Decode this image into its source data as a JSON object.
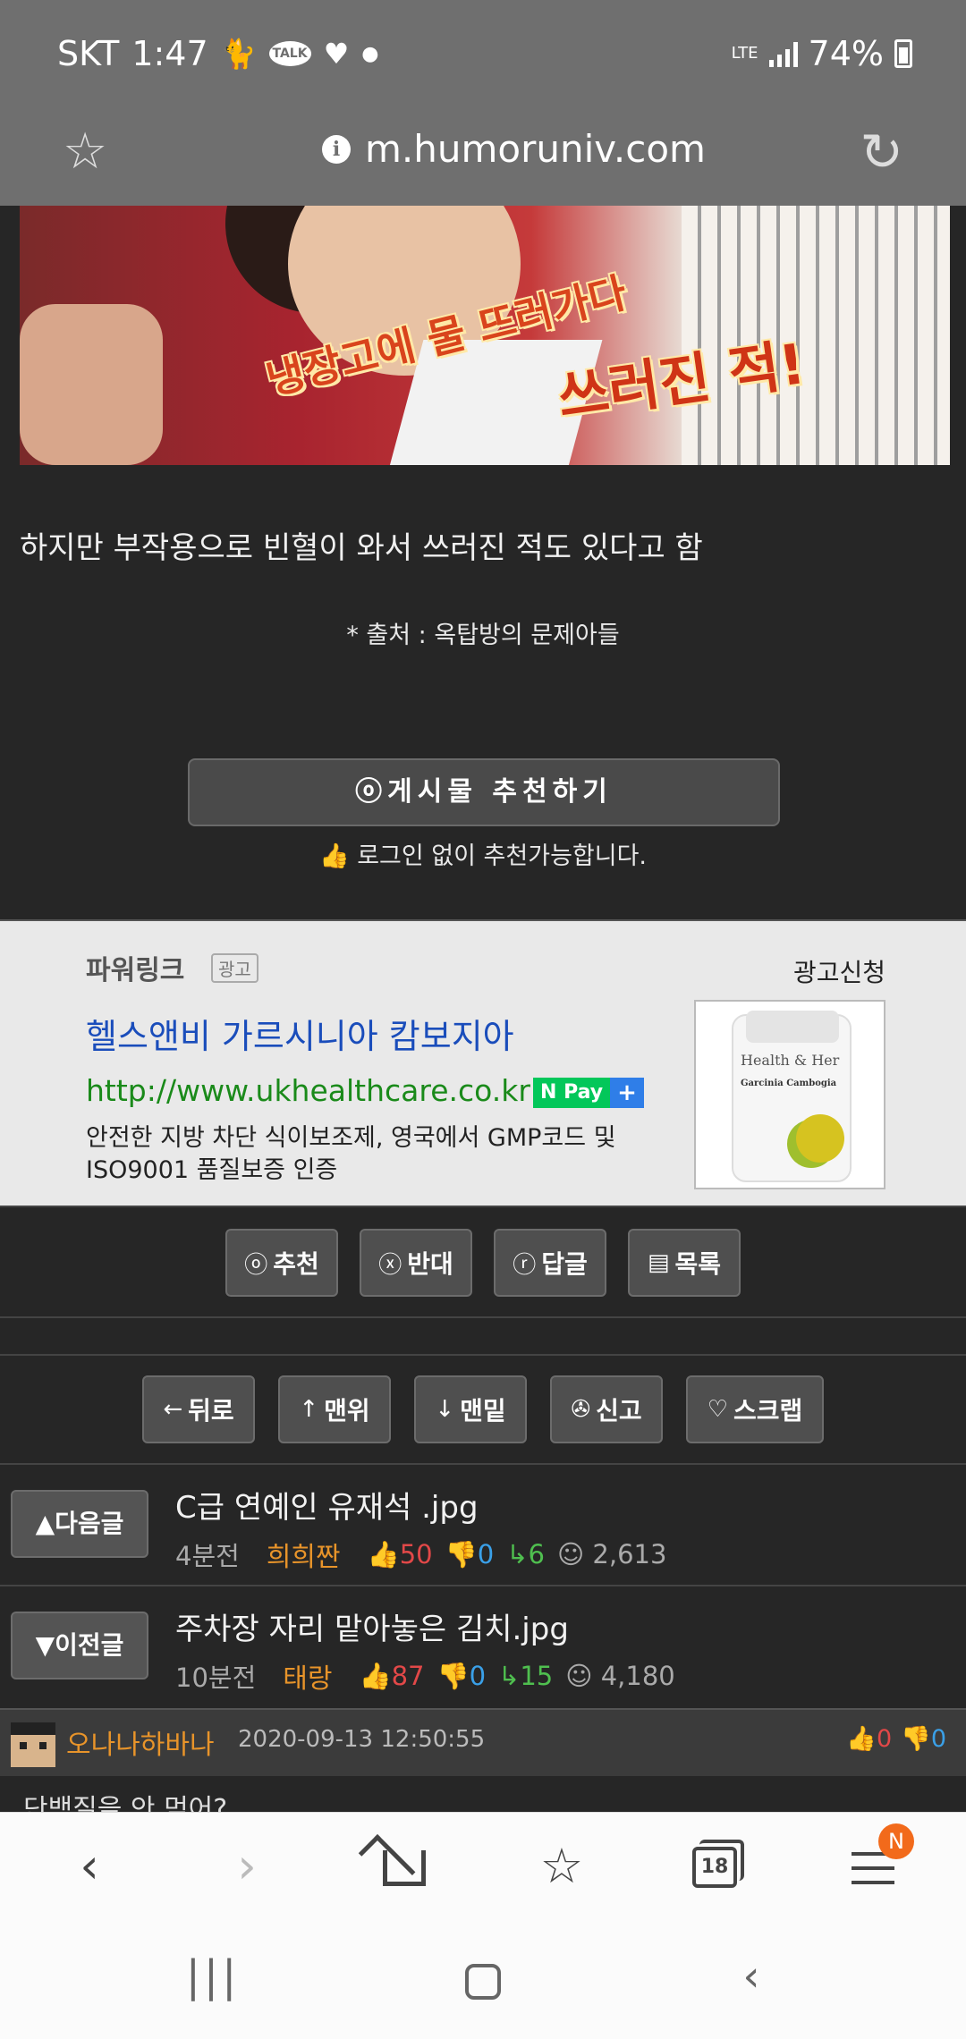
{
  "status_bar": {
    "carrier": "SKT",
    "time": "1:47",
    "notif_icons": [
      "cat-icon",
      "talk-icon",
      "heart-icon",
      "dot-icon"
    ],
    "talk_label": "TALK",
    "network": "LTE",
    "battery": "74%"
  },
  "browser": {
    "url": "m.humoruniv.com",
    "info_glyph": "i",
    "tab_count": "18",
    "menu_badge": "N"
  },
  "post": {
    "image_caption_1": "냉장고에 물 뜨러가다",
    "image_caption_2": "쓰러진 적!",
    "body_text": "하지만 부작용으로 빈혈이 와서 쓰러진 적도 있다고 함",
    "source": "* 출처 : 옥탑방의 문제아들",
    "recommend_button": "ⓞ게시물 추천하기",
    "recommend_note": "로그인 없이 추천가능합니다."
  },
  "ad": {
    "brand": "파워링크",
    "tag": "광고",
    "apply": "광고신청",
    "title": "헬스앤비 가르시니아 캄보지아",
    "link": "http://www.ukhealthcare.co.kr",
    "npay_label": "N Pay",
    "npay_plus": "+",
    "description": "안전한 지방 차단 식이보조제, 영국에서 GMP코드 및 ISO9001 품질보증 인증",
    "product_logo": "Health & Her",
    "product_name": "Garcinia Cambogia"
  },
  "actions_primary": [
    {
      "icon": "ⓞ",
      "label": "추천"
    },
    {
      "icon": "ⓧ",
      "label": "반대"
    },
    {
      "icon": "ⓡ",
      "label": "답글"
    },
    {
      "icon": "▤",
      "label": "목록"
    }
  ],
  "actions_secondary": [
    {
      "icon": "←",
      "label": "뒤로"
    },
    {
      "icon": "↑",
      "label": "맨위"
    },
    {
      "icon": "↓",
      "label": "맨밑"
    },
    {
      "icon": "✇",
      "label": "신고"
    },
    {
      "icon": "♡",
      "label": "스크랩"
    }
  ],
  "next_post": {
    "nav_label": "▲다음글",
    "title": "C급 연예인 유재석 .jpg",
    "time": "4분전",
    "author": "희희짠",
    "up": "50",
    "down": "0",
    "replies": "6",
    "views": "2,613"
  },
  "prev_post": {
    "nav_label": "▼이전글",
    "title": "주차장 자리 맡아놓은 김치.jpg",
    "time": "10분전",
    "author": "태랑",
    "up": "87",
    "down": "0",
    "replies": "15",
    "views": "4,180"
  },
  "comment": {
    "author": "오나나하바나",
    "date": "2020-09-13 12:50:55",
    "up": "0",
    "down": "0",
    "text_peek": "단백질을 안 먹어?"
  },
  "glyphs": {
    "thumb_up": "👍",
    "thumb_down": "👎",
    "reply": "↳",
    "view": "☺",
    "back": "‹",
    "forward": "›",
    "bookmarks": "☆",
    "star": "☆",
    "reload": "↻",
    "sys_recent": "|||",
    "sys_back": "‹"
  }
}
